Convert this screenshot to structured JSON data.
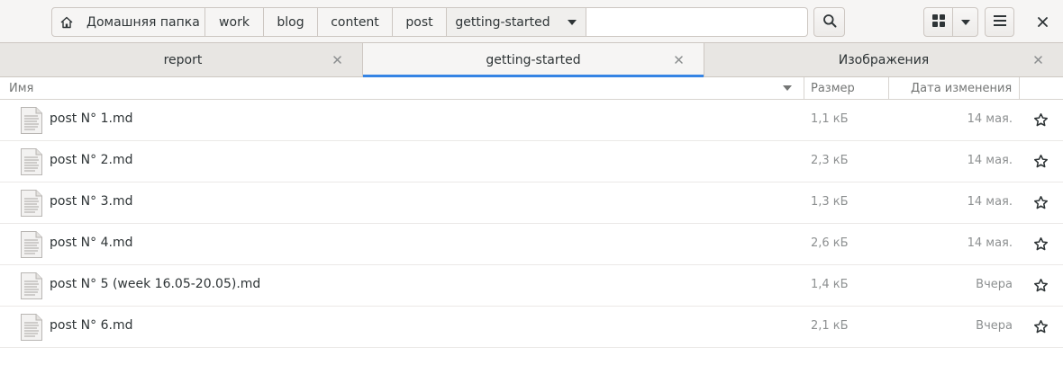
{
  "breadcrumbs": {
    "home_label": "Домашняя папка",
    "items": [
      "work",
      "blog",
      "content",
      "post",
      "getting-started"
    ]
  },
  "tabs": [
    {
      "label": "report"
    },
    {
      "label": "getting-started"
    },
    {
      "label": "Изображения"
    }
  ],
  "columns": {
    "name": "Имя",
    "size": "Размер",
    "date": "Дата изменения"
  },
  "files": [
    {
      "name": "post N° 1.md",
      "size": "1,1 кБ",
      "date": "14 мая."
    },
    {
      "name": "post N° 2.md",
      "size": "2,3 кБ",
      "date": "14 мая."
    },
    {
      "name": "post N° 3.md",
      "size": "1,3 кБ",
      "date": "14 мая."
    },
    {
      "name": "post N° 4.md",
      "size": "2,6 кБ",
      "date": "14 мая."
    },
    {
      "name": "post N° 5 (week 16.05-20.05).md",
      "size": "1,4 кБ",
      "date": "Вчера"
    },
    {
      "name": "post N° 6.md",
      "size": "2,1 кБ",
      "date": "Вчера"
    }
  ],
  "icons": {
    "home": "home-icon",
    "search": "search-icon",
    "grid": "grid-view-icon",
    "menu": "hamburger-menu-icon",
    "close": "close-icon",
    "star": "star-icon",
    "file": "text-file-icon"
  },
  "colors": {
    "accent": "#3584e4",
    "header_bg": "#f6f5f4",
    "tabbar_bg": "#e8e6e3"
  }
}
